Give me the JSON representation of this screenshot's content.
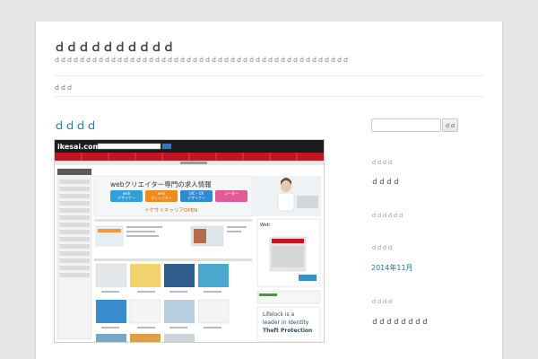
{
  "site": {
    "title": "ｄｄｄｄｄｄｄｄｄｄ",
    "description": "ｄｄｄｄｄｄｄｄｄｄｄｄｄｄｄｄｄｄｄｄｄｄｄｄｄｄｄｄｄｄｄｄｄｄｄｄｄｄｄｄｄｄｄｄｄｄｄ"
  },
  "nav": {
    "home": "ｄｄｄ"
  },
  "post": {
    "title": "ｄｄｄｄ",
    "thumbnail": {
      "logo": "ikesai.com",
      "banner_main": "webクリエイター専門の求人情報",
      "banner_sub": "イケサイキャリアOPEN",
      "banner_tags": [
        "web\nデザイナー",
        "web\nディレクター",
        "UIC・UX\nデザイナー",
        "コーダー"
      ],
      "right_head": "Web",
      "ad_text": [
        "Lifelock is a",
        "leader in Identity",
        "Theft Protection"
      ]
    }
  },
  "sidebar": {
    "search_placeholder": "",
    "search_button": "ｄｄ",
    "widgets": [
      {
        "title": "ｄｄｄｄ",
        "items": [
          "ｄｄｄｄ"
        ],
        "link": false
      },
      {
        "title": "ｄｄｄｄｄｄ",
        "items": [],
        "link": false
      },
      {
        "title": "ｄｄｄｄ",
        "items": [
          "2014年11月"
        ],
        "link": true
      },
      {
        "title": "ｄｄｄｄ",
        "items": [
          "ｄｄｄｄｄｄｄｄ"
        ],
        "link": false
      }
    ]
  },
  "colors": {
    "link": "#21759b",
    "background": "#e6e6e6",
    "text": "#444444"
  }
}
